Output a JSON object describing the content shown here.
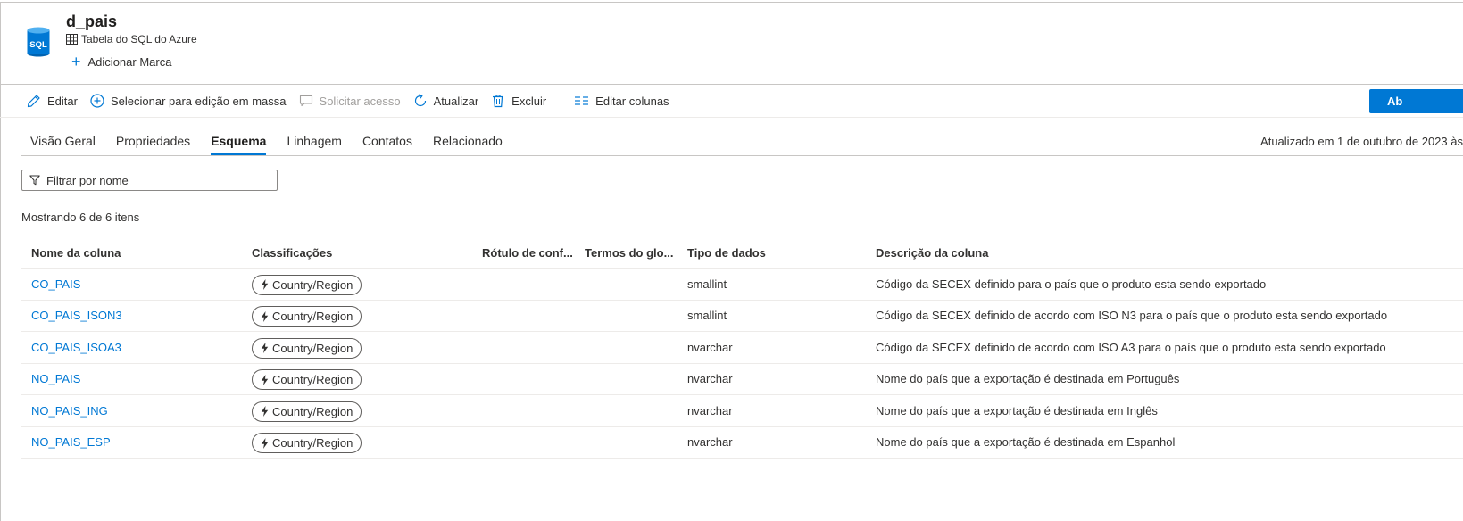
{
  "asset": {
    "title": "d_pais",
    "type_label": "Tabela do SQL do Azure",
    "add_tag_label": "Adicionar Marca",
    "icon": "sql-database-icon"
  },
  "toolbar": {
    "edit": "Editar",
    "bulk_select": "Selecionar para edição em massa",
    "request_access": "Solicitar acesso",
    "refresh": "Atualizar",
    "delete": "Excluir",
    "edit_columns": "Editar colunas",
    "primary": "Ab"
  },
  "tabs": [
    {
      "label": "Visão Geral",
      "active": false
    },
    {
      "label": "Propriedades",
      "active": false
    },
    {
      "label": "Esquema",
      "active": true
    },
    {
      "label": "Linhagem",
      "active": false
    },
    {
      "label": "Contatos",
      "active": false
    },
    {
      "label": "Relacionado",
      "active": false
    }
  ],
  "updated_text": "Atualizado em 1 de outubro de 2023 às",
  "filter": {
    "placeholder": "Filtrar por nome"
  },
  "count_text": "Mostrando 6 de 6 itens",
  "table": {
    "headers": {
      "column_name": "Nome da coluna",
      "classifications": "Classificações",
      "sensitivity_label": "Rótulo de conf...",
      "glossary_terms": "Termos do glo...",
      "data_type": "Tipo de dados",
      "description": "Descrição da coluna"
    },
    "rows": [
      {
        "name": "CO_PAIS",
        "classification": "Country/Region",
        "data_type": "smallint",
        "description": "Código da SECEX definido para o país que o produto esta sendo exportado"
      },
      {
        "name": "CO_PAIS_ISON3",
        "classification": "Country/Region",
        "data_type": "smallint",
        "description": "Código da SECEX definido de acordo com ISO N3 para o país que o produto esta sendo exportado"
      },
      {
        "name": "CO_PAIS_ISOA3",
        "classification": "Country/Region",
        "data_type": "nvarchar",
        "description": "Código da SECEX definido de acordo com ISO A3 para o país que o produto esta sendo exportado"
      },
      {
        "name": "NO_PAIS",
        "classification": "Country/Region",
        "data_type": "nvarchar",
        "description": "Nome do país que a exportação é destinada em Português"
      },
      {
        "name": "NO_PAIS_ING",
        "classification": "Country/Region",
        "data_type": "nvarchar",
        "description": "Nome do país que a exportação é destinada em Inglês"
      },
      {
        "name": "NO_PAIS_ESP",
        "classification": "Country/Region",
        "data_type": "nvarchar",
        "description": "Nome do país que a exportação é destinada em Espanhol"
      }
    ]
  },
  "colors": {
    "accent": "#0078d4",
    "text": "#323130",
    "disabled": "#a19f9d"
  }
}
